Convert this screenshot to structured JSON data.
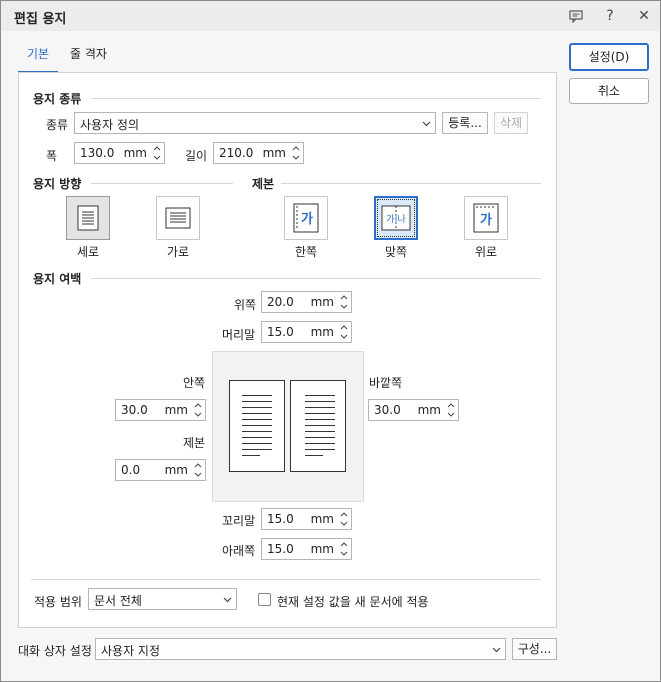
{
  "window": {
    "title": "편집 용지",
    "icons": [
      "chat-icon",
      "help-icon",
      "close-icon"
    ],
    "help_glyph": "?",
    "close_glyph": "✕"
  },
  "tabs": [
    {
      "label": "기본",
      "active": true
    },
    {
      "label": "줄 격자",
      "active": false
    }
  ],
  "buttons": {
    "ok": "설정(D)",
    "cancel": "취소"
  },
  "paper_type": {
    "section": "용지 종류",
    "type_label": "종류",
    "type_value": "사용자 정의",
    "register": "등록...",
    "delete": "삭제",
    "width_label": "폭",
    "width_value": "130.0",
    "height_label": "길이",
    "height_value": "210.0",
    "unit": "mm"
  },
  "orientation": {
    "section": "용지 방향",
    "portrait": "세로",
    "landscape": "가로",
    "selected": "portrait"
  },
  "binding": {
    "section": "제본",
    "single": "한쪽",
    "facing": "맞쪽",
    "top": "위로",
    "selected": "facing",
    "glyph": "가",
    "facing_glyph": "가|나"
  },
  "margins": {
    "section": "용지 여백",
    "top_label": "위쪽",
    "top_value": "20.0",
    "header_label": "머리말",
    "header_value": "15.0",
    "inside_label": "안쪽",
    "inside_value": "30.0",
    "outside_label": "바깥쪽",
    "outside_value": "30.0",
    "gutter_label": "제본",
    "gutter_value": "0.0",
    "footer_label": "꼬리말",
    "footer_value": "15.0",
    "bottom_label": "아래쪽",
    "bottom_value": "15.0",
    "unit": "mm"
  },
  "apply": {
    "label": "적용 범위",
    "value": "문서 전체",
    "checkbox_label": "현재 설정 값을 새 문서에 적용",
    "checked": false
  },
  "dialog_setting": {
    "label": "대화 상자 설정",
    "value": "사용자 지정",
    "config": "구성..."
  },
  "colors": {
    "accent": "#2c6ecb"
  }
}
